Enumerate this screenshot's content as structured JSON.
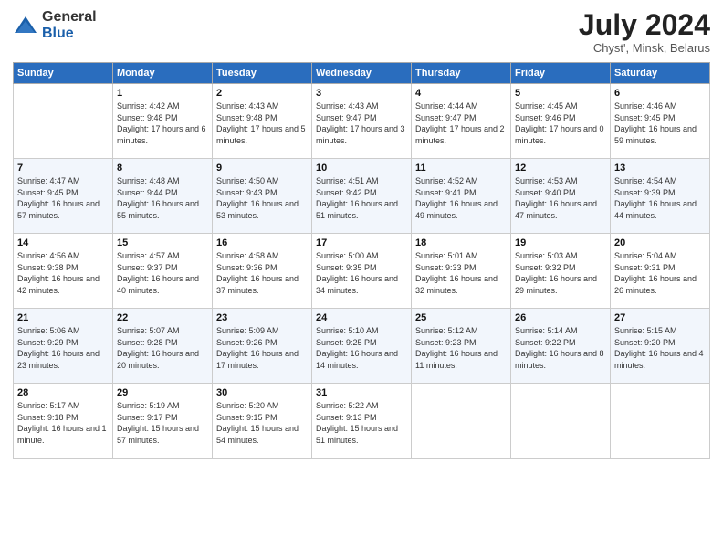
{
  "logo": {
    "general": "General",
    "blue": "Blue"
  },
  "header": {
    "month": "July 2024",
    "location": "Chyst', Minsk, Belarus"
  },
  "columns": [
    "Sunday",
    "Monday",
    "Tuesday",
    "Wednesday",
    "Thursday",
    "Friday",
    "Saturday"
  ],
  "weeks": [
    [
      {
        "day": "",
        "sunrise": "",
        "sunset": "",
        "daylight": ""
      },
      {
        "day": "1",
        "sunrise": "4:42 AM",
        "sunset": "9:48 PM",
        "daylight": "17 hours and 6 minutes."
      },
      {
        "day": "2",
        "sunrise": "4:43 AM",
        "sunset": "9:48 PM",
        "daylight": "17 hours and 5 minutes."
      },
      {
        "day": "3",
        "sunrise": "4:43 AM",
        "sunset": "9:47 PM",
        "daylight": "17 hours and 3 minutes."
      },
      {
        "day": "4",
        "sunrise": "4:44 AM",
        "sunset": "9:47 PM",
        "daylight": "17 hours and 2 minutes."
      },
      {
        "day": "5",
        "sunrise": "4:45 AM",
        "sunset": "9:46 PM",
        "daylight": "17 hours and 0 minutes."
      },
      {
        "day": "6",
        "sunrise": "4:46 AM",
        "sunset": "9:45 PM",
        "daylight": "16 hours and 59 minutes."
      }
    ],
    [
      {
        "day": "7",
        "sunrise": "4:47 AM",
        "sunset": "9:45 PM",
        "daylight": "16 hours and 57 minutes."
      },
      {
        "day": "8",
        "sunrise": "4:48 AM",
        "sunset": "9:44 PM",
        "daylight": "16 hours and 55 minutes."
      },
      {
        "day": "9",
        "sunrise": "4:50 AM",
        "sunset": "9:43 PM",
        "daylight": "16 hours and 53 minutes."
      },
      {
        "day": "10",
        "sunrise": "4:51 AM",
        "sunset": "9:42 PM",
        "daylight": "16 hours and 51 minutes."
      },
      {
        "day": "11",
        "sunrise": "4:52 AM",
        "sunset": "9:41 PM",
        "daylight": "16 hours and 49 minutes."
      },
      {
        "day": "12",
        "sunrise": "4:53 AM",
        "sunset": "9:40 PM",
        "daylight": "16 hours and 47 minutes."
      },
      {
        "day": "13",
        "sunrise": "4:54 AM",
        "sunset": "9:39 PM",
        "daylight": "16 hours and 44 minutes."
      }
    ],
    [
      {
        "day": "14",
        "sunrise": "4:56 AM",
        "sunset": "9:38 PM",
        "daylight": "16 hours and 42 minutes."
      },
      {
        "day": "15",
        "sunrise": "4:57 AM",
        "sunset": "9:37 PM",
        "daylight": "16 hours and 40 minutes."
      },
      {
        "day": "16",
        "sunrise": "4:58 AM",
        "sunset": "9:36 PM",
        "daylight": "16 hours and 37 minutes."
      },
      {
        "day": "17",
        "sunrise": "5:00 AM",
        "sunset": "9:35 PM",
        "daylight": "16 hours and 34 minutes."
      },
      {
        "day": "18",
        "sunrise": "5:01 AM",
        "sunset": "9:33 PM",
        "daylight": "16 hours and 32 minutes."
      },
      {
        "day": "19",
        "sunrise": "5:03 AM",
        "sunset": "9:32 PM",
        "daylight": "16 hours and 29 minutes."
      },
      {
        "day": "20",
        "sunrise": "5:04 AM",
        "sunset": "9:31 PM",
        "daylight": "16 hours and 26 minutes."
      }
    ],
    [
      {
        "day": "21",
        "sunrise": "5:06 AM",
        "sunset": "9:29 PM",
        "daylight": "16 hours and 23 minutes."
      },
      {
        "day": "22",
        "sunrise": "5:07 AM",
        "sunset": "9:28 PM",
        "daylight": "16 hours and 20 minutes."
      },
      {
        "day": "23",
        "sunrise": "5:09 AM",
        "sunset": "9:26 PM",
        "daylight": "16 hours and 17 minutes."
      },
      {
        "day": "24",
        "sunrise": "5:10 AM",
        "sunset": "9:25 PM",
        "daylight": "16 hours and 14 minutes."
      },
      {
        "day": "25",
        "sunrise": "5:12 AM",
        "sunset": "9:23 PM",
        "daylight": "16 hours and 11 minutes."
      },
      {
        "day": "26",
        "sunrise": "5:14 AM",
        "sunset": "9:22 PM",
        "daylight": "16 hours and 8 minutes."
      },
      {
        "day": "27",
        "sunrise": "5:15 AM",
        "sunset": "9:20 PM",
        "daylight": "16 hours and 4 minutes."
      }
    ],
    [
      {
        "day": "28",
        "sunrise": "5:17 AM",
        "sunset": "9:18 PM",
        "daylight": "16 hours and 1 minute."
      },
      {
        "day": "29",
        "sunrise": "5:19 AM",
        "sunset": "9:17 PM",
        "daylight": "15 hours and 57 minutes."
      },
      {
        "day": "30",
        "sunrise": "5:20 AM",
        "sunset": "9:15 PM",
        "daylight": "15 hours and 54 minutes."
      },
      {
        "day": "31",
        "sunrise": "5:22 AM",
        "sunset": "9:13 PM",
        "daylight": "15 hours and 51 minutes."
      },
      {
        "day": "",
        "sunrise": "",
        "sunset": "",
        "daylight": ""
      },
      {
        "day": "",
        "sunrise": "",
        "sunset": "",
        "daylight": ""
      },
      {
        "day": "",
        "sunrise": "",
        "sunset": "",
        "daylight": ""
      }
    ]
  ]
}
